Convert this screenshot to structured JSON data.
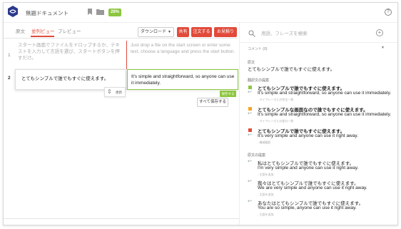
{
  "app": {
    "doc_title": "無題ドキュメント",
    "progress_badge": "28%",
    "help_symbol": "?",
    "icons": {
      "logo": "translator-logo-icon",
      "bookmark": "bookmark-icon",
      "folder": "folder-icon",
      "help": "help-icon"
    }
  },
  "tabs": [
    {
      "label": "原文"
    },
    {
      "label": "並列ビュー"
    },
    {
      "label": "プレビュー"
    }
  ],
  "toolbar": {
    "download_select": "ダウンロード",
    "share": "共有",
    "order": "注文する",
    "quote": "お見積り"
  },
  "editor": {
    "row1_num": "1",
    "row2_num": "2",
    "source_placeholder": "スタート画面でファイルをドロップするか、テキストを入力して言語を選び、スタートボタンを押すだけ。",
    "target_placeholder": "Just drop a file on the start screen or enter some text, choose a language and press the start button.",
    "source_text": "とてもシンプルで誰でもすぐに使えます。",
    "target_text": "It's simple and straightforward, so anyone can use it immediately.",
    "save_tag": "保存する",
    "update_label": "更新",
    "save_all": "すべて保存する"
  },
  "right_panel": {
    "search_placeholder": "用語、フレーズを検索",
    "comments_label": "コメント",
    "comments_count": "(0)",
    "original_heading": "原文",
    "original_text": "とてもシンプルで誰でもすぐに使えます。",
    "suggestion_heading": "翻訳文の提案",
    "suggestions": [
      {
        "src": "とてもシンプルで誰でもすぐに使えます。",
        "tgt": "It's simple and straightforward, so anyone can use it immediately.",
        "note": "- マイフレーズとの完全一致",
        "color": "#8cc63f"
      },
      {
        "src": "とてもシンプルな画面なので誰でもすぐに使えます。",
        "tgt": "It's simple and straightforward, so anyone can use it immediately.",
        "note": "- マイフレーズとの部分一致",
        "color": "#f5a623"
      },
      {
        "src": "とてもシンプルで誰でもすぐに使えます。",
        "tgt": "It's very simple and anyone can use it right away.",
        "note": "- 機械翻訳",
        "color": "#e14a3a"
      }
    ],
    "alt_heading": "原文の提案",
    "alternatives": [
      {
        "src": "私はとてもシンプルで誰でもすぐに使えます。",
        "tgt": "I'm very simple and anyone can use it right away.",
        "note": "- 主語を追加"
      },
      {
        "src": "我々はとてもシンプルで誰でもすぐに使えます。",
        "tgt": "We are very simple and anyone can use it right away.",
        "note": "- 主語を追加"
      },
      {
        "src": "あなたはとてもシンプルで誰でもすぐに使えます。",
        "tgt": "You are so simple, anyone can use it right away.",
        "note": "- 主語を追加"
      }
    ]
  }
}
